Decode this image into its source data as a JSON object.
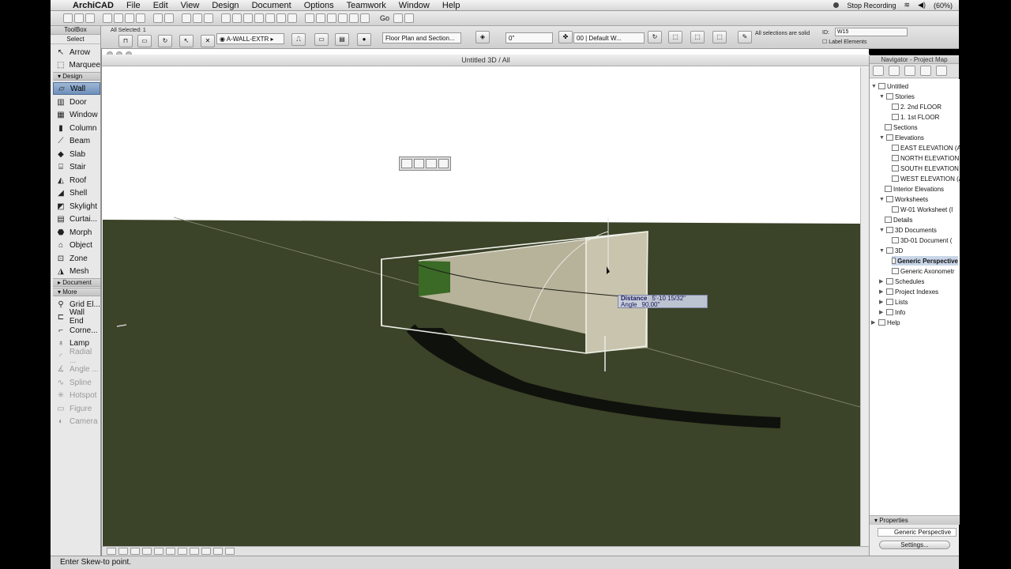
{
  "menubar": {
    "app": "ArchiCAD",
    "items": [
      "File",
      "Edit",
      "View",
      "Design",
      "Document",
      "Options",
      "Teamwork",
      "Window",
      "Help"
    ],
    "stop_recording": "Stop Recording",
    "battery": "(60%)"
  },
  "infobox": {
    "selection": "All Selected: 1",
    "layer": "A-WALL-EXTR",
    "floor_plan_section": "Floor Plan and Section...",
    "angle_value": "0\"",
    "story": "00 | Default W...",
    "all_selections_solid": "All selections are solid",
    "id_label": "ID:",
    "id_value": "W15",
    "label_elements": "Label Elements"
  },
  "toolbox": {
    "title": "ToolBox",
    "select": "Select",
    "design_cat": "Design",
    "document_cat": "Document",
    "more_cat": "More",
    "arrow": "Arrow",
    "marquee": "Marquee",
    "tools_design": [
      "Wall",
      "Door",
      "Window",
      "Column",
      "Beam",
      "Slab",
      "Stair",
      "Roof",
      "Shell",
      "Skylight",
      "Curtai...",
      "Morph",
      "Object",
      "Zone",
      "Mesh"
    ],
    "tools_more": [
      "Grid El...",
      "Wall End",
      "Corne...",
      "Lamp",
      "Radial ...",
      "Angle ...",
      "Spline",
      "Hotspot",
      "Figure",
      "Camera"
    ]
  },
  "window3d": {
    "title": "Untitled 3D / All"
  },
  "tracker": {
    "distance_label": "Distance",
    "distance_value": "5'-10 15/32\"",
    "angle_label": "Angle",
    "angle_value": "90.00\""
  },
  "navigator": {
    "title": "Navigator - Project Map",
    "tree": [
      "Untitled",
      "Stories",
      "2. 2nd FLOOR",
      "1. 1st FLOOR",
      "Sections",
      "Elevations",
      "EAST ELEVATION (A",
      "NORTH ELEVATION",
      "SOUTH ELEVATION",
      "WEST ELEVATION (A",
      "Interior Elevations",
      "Worksheets",
      "W-01 Worksheet (I",
      "Details",
      "3D Documents",
      "3D-01 Document (",
      "3D",
      "Generic Perspective",
      "Generic Axonometr",
      "Schedules",
      "Project Indexes",
      "Lists",
      "Info",
      "Help"
    ],
    "properties_label": "Properties",
    "properties_view": "Generic Perspective",
    "settings_label": "Settings..."
  },
  "status": {
    "text": "Enter Skew-to point."
  },
  "colors": {
    "ground": "#3b4328",
    "selection": "#6d8fba",
    "wall_fill": "#b7b29a"
  }
}
